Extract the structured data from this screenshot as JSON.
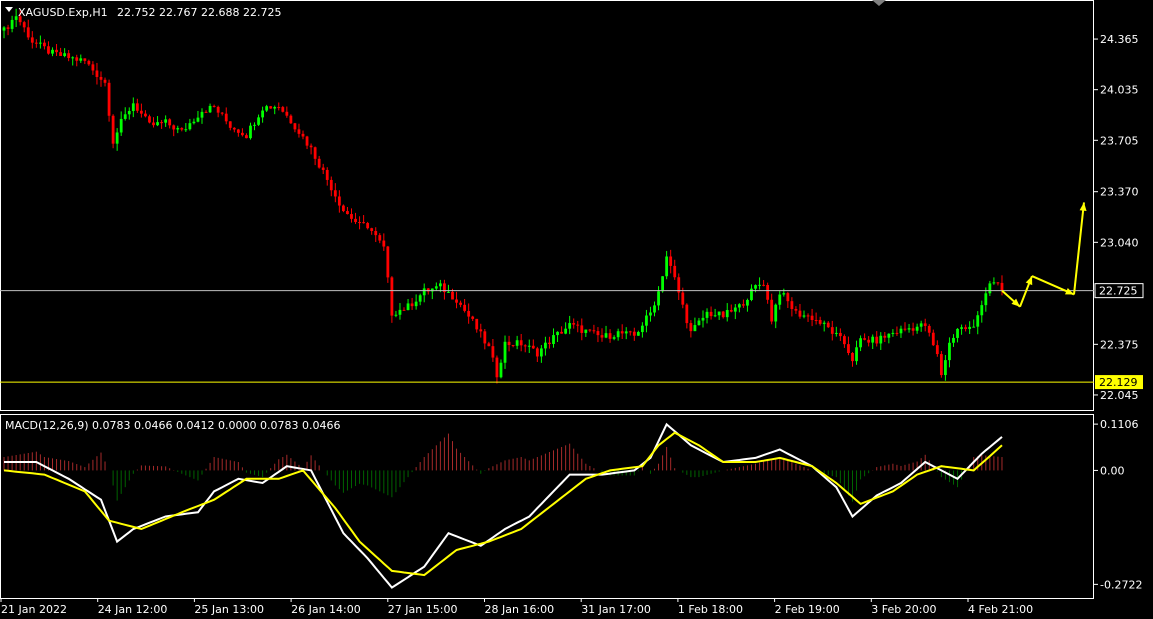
{
  "header": {
    "symbol_label": "XAGUSD.Exp,H1",
    "ohlc_label": "22.752 22.767 22.688 22.725",
    "macd_label": "MACD(12,26,9) 0.0783 0.0466 0.0412 0.0000 0.0783 0.0466"
  },
  "colors": {
    "background": "#000000",
    "bull": "#00ff00",
    "bear": "#ff0000",
    "macd_main": "#ffffff",
    "macd_signal": "#ffff00",
    "hist_pos": "#a52a2a",
    "hist_neg": "#006400",
    "frame": "#ffffff",
    "price_line": "#c0c0c0",
    "level_line": "#ffff00",
    "arrows": "#ffff00"
  },
  "chart_data": [
    {
      "type": "candlestick",
      "title": "XAGUSD.Exp,H1",
      "ylim": [
        21.96,
        24.6
      ],
      "y_ticks": [
        "24.365",
        "24.035",
        "23.705",
        "23.370",
        "23.040",
        "22.375",
        "22.045"
      ],
      "x_ticks": [
        "21 Jan 2022",
        "24 Jan 12:00",
        "25 Jan 13:00",
        "26 Jan 14:00",
        "27 Jan 15:00",
        "28 Jan 16:00",
        "31 Jan 17:00",
        "1 Feb 18:00",
        "2 Feb 19:00",
        "3 Feb 20:00",
        "4 Feb 21:00"
      ],
      "current_price": {
        "value": 22.725,
        "label": "22.725"
      },
      "horizontal_level": {
        "value": 22.129,
        "label": "22.129"
      },
      "close_path": [
        [
          0,
          24.42
        ],
        [
          3,
          24.52
        ],
        [
          7,
          24.35
        ],
        [
          12,
          24.27
        ],
        [
          20,
          24.22
        ],
        [
          25,
          24.08
        ],
        [
          27,
          23.7
        ],
        [
          29,
          23.82
        ],
        [
          32,
          23.95
        ],
        [
          36,
          23.8
        ],
        [
          40,
          23.82
        ],
        [
          44,
          23.76
        ],
        [
          49,
          23.9
        ],
        [
          52,
          23.92
        ],
        [
          56,
          23.8
        ],
        [
          60,
          23.74
        ],
        [
          64,
          23.92
        ],
        [
          68,
          23.93
        ],
        [
          72,
          23.8
        ],
        [
          76,
          23.65
        ],
        [
          80,
          23.45
        ],
        [
          84,
          23.25
        ],
        [
          88,
          23.15
        ],
        [
          90,
          23.15
        ],
        [
          94,
          23.0
        ],
        [
          96,
          22.58
        ],
        [
          100,
          22.62
        ],
        [
          104,
          22.72
        ],
        [
          108,
          22.75
        ],
        [
          112,
          22.67
        ],
        [
          116,
          22.52
        ],
        [
          120,
          22.35
        ],
        [
          122,
          22.18
        ],
        [
          124,
          22.38
        ],
        [
          128,
          22.38
        ],
        [
          132,
          22.32
        ],
        [
          136,
          22.42
        ],
        [
          140,
          22.5
        ],
        [
          144,
          22.46
        ],
        [
          148,
          22.42
        ],
        [
          152,
          22.45
        ],
        [
          156,
          22.43
        ],
        [
          160,
          22.58
        ],
        [
          162,
          22.72
        ],
        [
          164,
          22.95
        ],
        [
          166,
          22.8
        ],
        [
          170,
          22.45
        ],
        [
          174,
          22.58
        ],
        [
          178,
          22.56
        ],
        [
          182,
          22.62
        ],
        [
          186,
          22.75
        ],
        [
          188,
          22.78
        ],
        [
          190,
          22.54
        ],
        [
          192,
          22.72
        ],
        [
          196,
          22.58
        ],
        [
          200,
          22.55
        ],
        [
          204,
          22.48
        ],
        [
          208,
          22.38
        ],
        [
          210,
          22.28
        ],
        [
          212,
          22.4
        ],
        [
          216,
          22.4
        ],
        [
          220,
          22.45
        ],
        [
          224,
          22.48
        ],
        [
          228,
          22.5
        ],
        [
          231,
          22.3
        ],
        [
          232,
          22.18
        ],
        [
          234,
          22.38
        ],
        [
          236,
          22.48
        ],
        [
          240,
          22.48
        ],
        [
          242,
          22.65
        ],
        [
          244,
          22.78
        ],
        [
          247,
          22.74
        ]
      ],
      "projection": [
        [
          22.725,
          22.62
        ],
        [
          22.62,
          22.82
        ],
        [
          22.82,
          22.7
        ],
        [
          22.7,
          23.3
        ]
      ]
    },
    {
      "type": "line",
      "title": "MACD(12,26,9)",
      "ylim": [
        -0.3,
        0.13
      ],
      "y_ticks": [
        "0.1106",
        "0.00",
        "-0.2722"
      ],
      "series": [
        {
          "name": "MACD",
          "values": [
            [
              0,
              0.02
            ],
            [
              8,
              0.02
            ],
            [
              16,
              -0.02
            ],
            [
              24,
              -0.07
            ],
            [
              28,
              -0.17
            ],
            [
              32,
              -0.14
            ],
            [
              40,
              -0.11
            ],
            [
              48,
              -0.1
            ],
            [
              52,
              -0.05
            ],
            [
              58,
              -0.02
            ],
            [
              64,
              -0.03
            ],
            [
              70,
              0.01
            ],
            [
              76,
              0.0
            ],
            [
              84,
              -0.15
            ],
            [
              90,
              -0.21
            ],
            [
              96,
              -0.28
            ],
            [
              104,
              -0.23
            ],
            [
              110,
              -0.15
            ],
            [
              118,
              -0.18
            ],
            [
              124,
              -0.14
            ],
            [
              130,
              -0.11
            ],
            [
              136,
              -0.05
            ],
            [
              140,
              -0.01
            ],
            [
              148,
              -0.01
            ],
            [
              156,
              0.0
            ],
            [
              160,
              0.03
            ],
            [
              164,
              0.11
            ],
            [
              170,
              0.06
            ],
            [
              178,
              0.02
            ],
            [
              186,
              0.03
            ],
            [
              192,
              0.05
            ],
            [
              200,
              0.01
            ],
            [
              206,
              -0.04
            ],
            [
              210,
              -0.11
            ],
            [
              216,
              -0.06
            ],
            [
              222,
              -0.03
            ],
            [
              228,
              0.02
            ],
            [
              232,
              0.0
            ],
            [
              236,
              -0.02
            ],
            [
              242,
              0.04
            ],
            [
              247,
              0.08
            ]
          ]
        },
        {
          "name": "Signal",
          "values": [
            [
              0,
              0.0
            ],
            [
              10,
              -0.01
            ],
            [
              20,
              -0.05
            ],
            [
              26,
              -0.12
            ],
            [
              34,
              -0.14
            ],
            [
              44,
              -0.1
            ],
            [
              52,
              -0.07
            ],
            [
              60,
              -0.02
            ],
            [
              68,
              -0.02
            ],
            [
              74,
              0.0
            ],
            [
              82,
              -0.09
            ],
            [
              88,
              -0.17
            ],
            [
              96,
              -0.24
            ],
            [
              104,
              -0.25
            ],
            [
              112,
              -0.19
            ],
            [
              120,
              -0.17
            ],
            [
              128,
              -0.14
            ],
            [
              136,
              -0.08
            ],
            [
              144,
              -0.02
            ],
            [
              150,
              0.0
            ],
            [
              158,
              0.01
            ],
            [
              162,
              0.06
            ],
            [
              166,
              0.09
            ],
            [
              172,
              0.06
            ],
            [
              178,
              0.02
            ],
            [
              186,
              0.02
            ],
            [
              192,
              0.03
            ],
            [
              200,
              0.01
            ],
            [
              206,
              -0.03
            ],
            [
              212,
              -0.08
            ],
            [
              220,
              -0.05
            ],
            [
              226,
              -0.01
            ],
            [
              232,
              0.01
            ],
            [
              240,
              0.0
            ],
            [
              247,
              0.06
            ]
          ]
        }
      ]
    }
  ]
}
